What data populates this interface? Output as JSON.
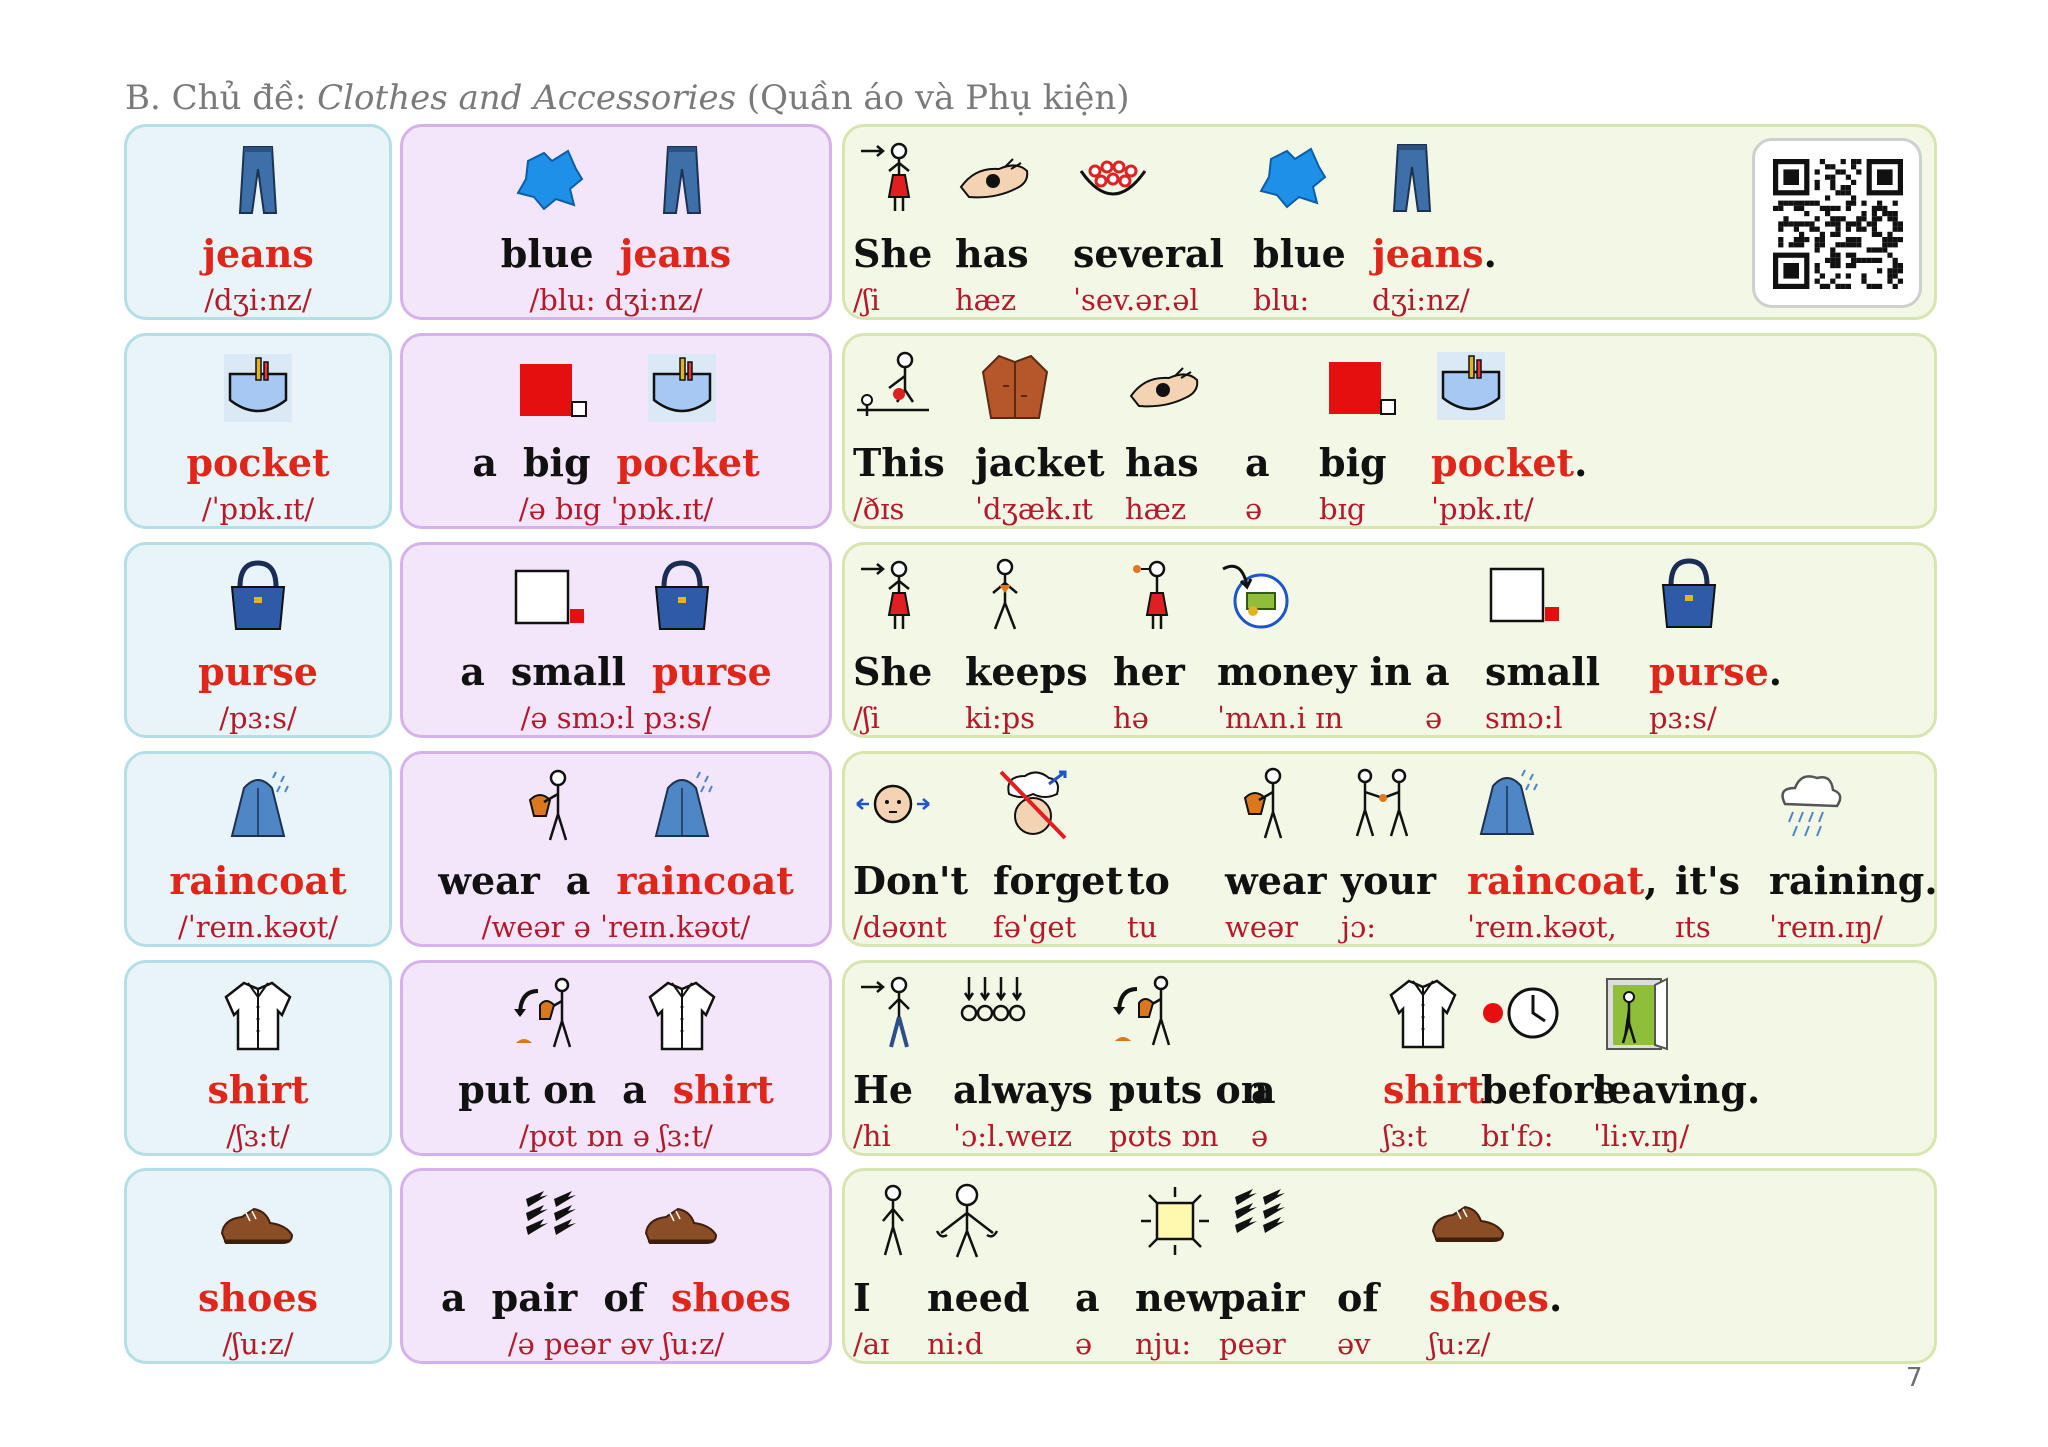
{
  "header": {
    "prefix": "B. Chủ đề: ",
    "topic": "Clothes and Accessories",
    "suffix": " (Quần áo và Phụ kiện)"
  },
  "page_number": "7",
  "rows": [
    {
      "word": "jeans",
      "word_ipa": "/dʒi:nz/",
      "phrase": [
        {
          "t": "blue",
          "kw": false,
          "icon": "blue-color-icon"
        },
        {
          "t": "jeans",
          "kw": true,
          "icon": "jeans-icon"
        }
      ],
      "phrase_ipa": "/blu:  dʒi:nz/",
      "sentence": [
        {
          "t": "She",
          "p": "/ʃi",
          "icon": "woman-icon"
        },
        {
          "t": "has",
          "p": "hæz",
          "icon": "hand-holding-icon"
        },
        {
          "t": "several",
          "p": "ˈsev.ər.əl",
          "icon": "several-dots-icon"
        },
        {
          "t": "blue",
          "p": "blu:",
          "icon": "blue-color-icon"
        },
        {
          "t": "jeans",
          "p": "dʒi:nz/",
          "icon": "jeans-icon",
          "kw": true,
          "punct": "."
        }
      ]
    },
    {
      "word": "pocket",
      "word_ipa": "/ˈpɒk.ɪt/",
      "phrase": [
        {
          "t": "a",
          "kw": false,
          "icon": ""
        },
        {
          "t": "big",
          "kw": false,
          "icon": "big-square-icon"
        },
        {
          "t": "pocket",
          "kw": true,
          "icon": "pocket-icon"
        }
      ],
      "phrase_ipa": "/ə  bɪg  ˈpɒk.ɪt/",
      "sentence": [
        {
          "t": "This",
          "p": "/ðɪs",
          "icon": "this-pointing-icon"
        },
        {
          "t": "jacket",
          "p": "ˈdʒæk.ɪt",
          "icon": "jacket-icon"
        },
        {
          "t": "has",
          "p": "hæz",
          "icon": "hand-holding-icon"
        },
        {
          "t": "a",
          "p": "ə",
          "icon": ""
        },
        {
          "t": "big",
          "p": "bɪg",
          "icon": "big-square-icon"
        },
        {
          "t": "pocket",
          "p": "ˈpɒk.ɪt/",
          "icon": "pocket-icon",
          "kw": true,
          "punct": "."
        }
      ]
    },
    {
      "word": "purse",
      "word_ipa": "/pɜ:s/",
      "phrase": [
        {
          "t": "a",
          "kw": false,
          "icon": ""
        },
        {
          "t": "small",
          "kw": false,
          "icon": "small-square-icon"
        },
        {
          "t": "purse",
          "kw": true,
          "icon": "purse-icon"
        }
      ],
      "phrase_ipa": "/ə  smɔ:l  pɜ:s/",
      "sentence": [
        {
          "t": "She",
          "p": "/ʃi",
          "icon": "woman-icon"
        },
        {
          "t": "keeps",
          "p": "ki:ps",
          "icon": "person-keeps-icon"
        },
        {
          "t": "her",
          "p": "hə",
          "icon": "her-icon"
        },
        {
          "t": "money in",
          "p": "ˈmʌn.i        ɪn",
          "icon": "money-icon"
        },
        {
          "t": "a",
          "p": "ə",
          "icon": ""
        },
        {
          "t": "small",
          "p": "smɔ:l",
          "icon": "small-square-icon"
        },
        {
          "t": "purse",
          "p": "pɜ:s/",
          "icon": "purse-icon",
          "kw": true,
          "punct": "."
        }
      ]
    },
    {
      "word": "raincoat",
      "word_ipa": "/ˈreɪn.kəʊt/",
      "phrase": [
        {
          "t": "wear",
          "kw": false,
          "icon": "wear-icon"
        },
        {
          "t": "a",
          "kw": false,
          "icon": ""
        },
        {
          "t": "raincoat",
          "kw": true,
          "icon": "raincoat-icon"
        }
      ],
      "phrase_ipa": "/weər  ə  ˈreɪn.kəʊt/",
      "sentence": [
        {
          "t": "Don't",
          "p": "/dəʊnt",
          "icon": "dont-head-icon"
        },
        {
          "t": "forget",
          "p": "fəˈget",
          "icon": "forget-icon"
        },
        {
          "t": "to",
          "p": "tu",
          "icon": ""
        },
        {
          "t": "wear",
          "p": "weər",
          "icon": "wear-icon"
        },
        {
          "t": "your",
          "p": "jɔ:",
          "icon": "your-icon"
        },
        {
          "t": "raincoat",
          "p": "ˈreɪn.kəʊt,",
          "icon": "raincoat-icon",
          "kw": true,
          "punct": ","
        },
        {
          "t": "it's",
          "p": "ɪts",
          "icon": ""
        },
        {
          "t": "raining",
          "p": "ˈreɪn.ɪŋ/",
          "icon": "rain-cloud-icon",
          "punct": "."
        }
      ]
    },
    {
      "word": "shirt",
      "word_ipa": "/ʃɜ:t/",
      "phrase": [
        {
          "t": "put on",
          "kw": false,
          "icon": "put-on-icon"
        },
        {
          "t": "a",
          "kw": false,
          "icon": ""
        },
        {
          "t": "shirt",
          "kw": true,
          "icon": "shirt-icon"
        }
      ],
      "phrase_ipa": "/pʊt  ɒn  ə  ʃɜ:t/",
      "sentence": [
        {
          "t": "He",
          "p": "/hi",
          "icon": "man-icon"
        },
        {
          "t": "always",
          "p": "ˈɔ:l.weɪz",
          "icon": "always-icon"
        },
        {
          "t": "puts on",
          "p": "pʊts       ɒn",
          "icon": "put-on-icon"
        },
        {
          "t": "a",
          "p": "ə",
          "icon": ""
        },
        {
          "t": "shirt",
          "p": "ʃɜ:t",
          "icon": "shirt-icon",
          "kw": true
        },
        {
          "t": "before",
          "p": "bɪˈfɔ:",
          "icon": "before-clock-icon"
        },
        {
          "t": "leaving",
          "p": "ˈli:v.ɪŋ/",
          "icon": "leaving-door-icon",
          "punct": "."
        }
      ]
    },
    {
      "word": "shoes",
      "word_ipa": "/ʃu:z/",
      "phrase": [
        {
          "t": "a",
          "kw": false,
          "icon": ""
        },
        {
          "t": "pair",
          "kw": false,
          "icon": "pair-icon"
        },
        {
          "t": "of",
          "kw": false,
          "icon": ""
        },
        {
          "t": "shoes",
          "kw": true,
          "icon": "shoes-icon"
        }
      ],
      "phrase_ipa": "/ə  peər  əv  ʃu:z/",
      "sentence": [
        {
          "t": "I",
          "p": "/aɪ",
          "icon": "person-i-icon"
        },
        {
          "t": "need",
          "p": "ni:d",
          "icon": "need-icon"
        },
        {
          "t": "a",
          "p": "ə",
          "icon": ""
        },
        {
          "t": "new",
          "p": "nju:",
          "icon": "new-sun-icon"
        },
        {
          "t": "pair",
          "p": "peər",
          "icon": "pair-icon"
        },
        {
          "t": "of",
          "p": "əv",
          "icon": ""
        },
        {
          "t": "shoes",
          "p": "ʃu:z/",
          "icon": "shoes-icon",
          "kw": true,
          "punct": "."
        }
      ]
    }
  ]
}
